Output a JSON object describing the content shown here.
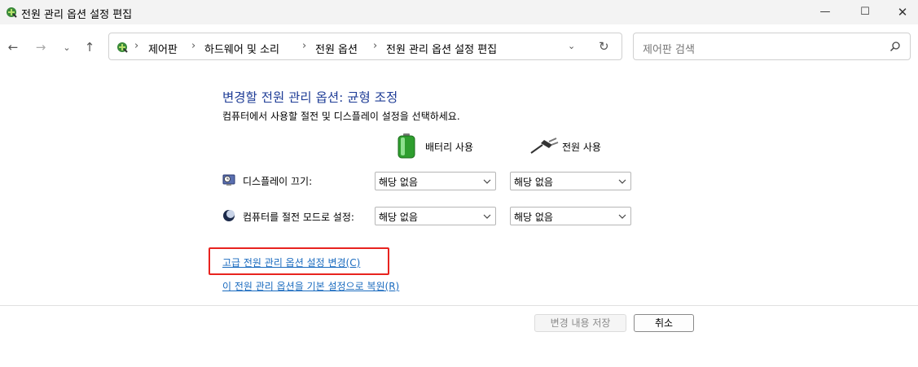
{
  "window": {
    "title": "전원 관리 옵션 설정 편집",
    "controls": {
      "minimize": "—",
      "maximize": "☐",
      "close": "✕"
    }
  },
  "nav": {
    "back": "←",
    "forward": "→",
    "recent": "⌄",
    "up": "↑"
  },
  "address": {
    "crumbs": [
      "제어판",
      "하드웨어 및 소리",
      "전원 옵션",
      "전원 관리 옵션 설정 편집"
    ],
    "separator": "›",
    "dropdown": "⌄",
    "refresh": "↻"
  },
  "search": {
    "placeholder": "제어판 검색"
  },
  "main": {
    "heading": "변경할 전원 관리 옵션: 균형 조정",
    "subtitle": "컴퓨터에서 사용할 절전 및 디스플레이 설정을 선택하세요.",
    "columns": {
      "battery": "배터리 사용",
      "plugged": "전원 사용"
    },
    "rows": [
      {
        "label": "디스플레이 끄기:",
        "battery_value": "해당 없음",
        "plugged_value": "해당 없음",
        "icon": "display-clock-icon"
      },
      {
        "label": "컴퓨터를 절전 모드로 설정:",
        "battery_value": "해당 없음",
        "plugged_value": "해당 없음",
        "icon": "sleep-moon-icon"
      }
    ],
    "links": {
      "advanced": "고급 전원 관리 옵션 설정 변경(C)",
      "restore": "이 전원 관리 옵션을 기본 설정으로 복원(R)"
    }
  },
  "footer": {
    "save": "변경 내용 저장",
    "cancel": "취소"
  },
  "colors": {
    "heading": "#1e3c96",
    "link": "#1a6bbf",
    "highlight": "#e8231f"
  }
}
